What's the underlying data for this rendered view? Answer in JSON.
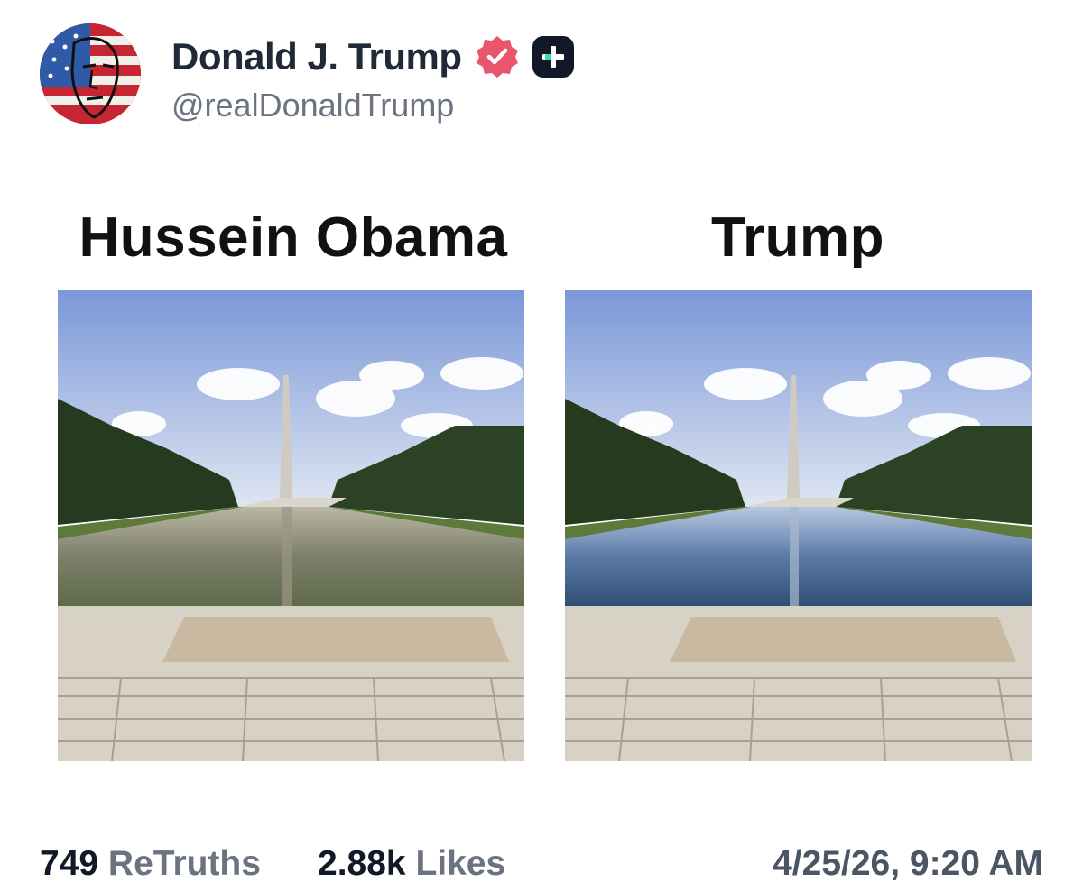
{
  "post": {
    "author_name": "Donald J. Trump",
    "handle": "@realDonaldTrump",
    "images": [
      {
        "caption": "Hussein Obama",
        "water": "murky-green"
      },
      {
        "caption": "Trump",
        "water": "clear-blue"
      }
    ],
    "stats": {
      "retruths_count": "749",
      "retruths_label": "ReTruths",
      "likes_count": "2.88k",
      "likes_label": "Likes"
    },
    "timestamp": "4/25/26, 9:20 AM"
  },
  "icons": {
    "verified": "verified-badge-icon",
    "plus": "plus-badge-icon"
  },
  "colors": {
    "verified_badge": "#e8556d",
    "plus_badge_bg": "#111827",
    "plus_accent": "#3fd9b0",
    "handle_text": "#6b7280"
  }
}
